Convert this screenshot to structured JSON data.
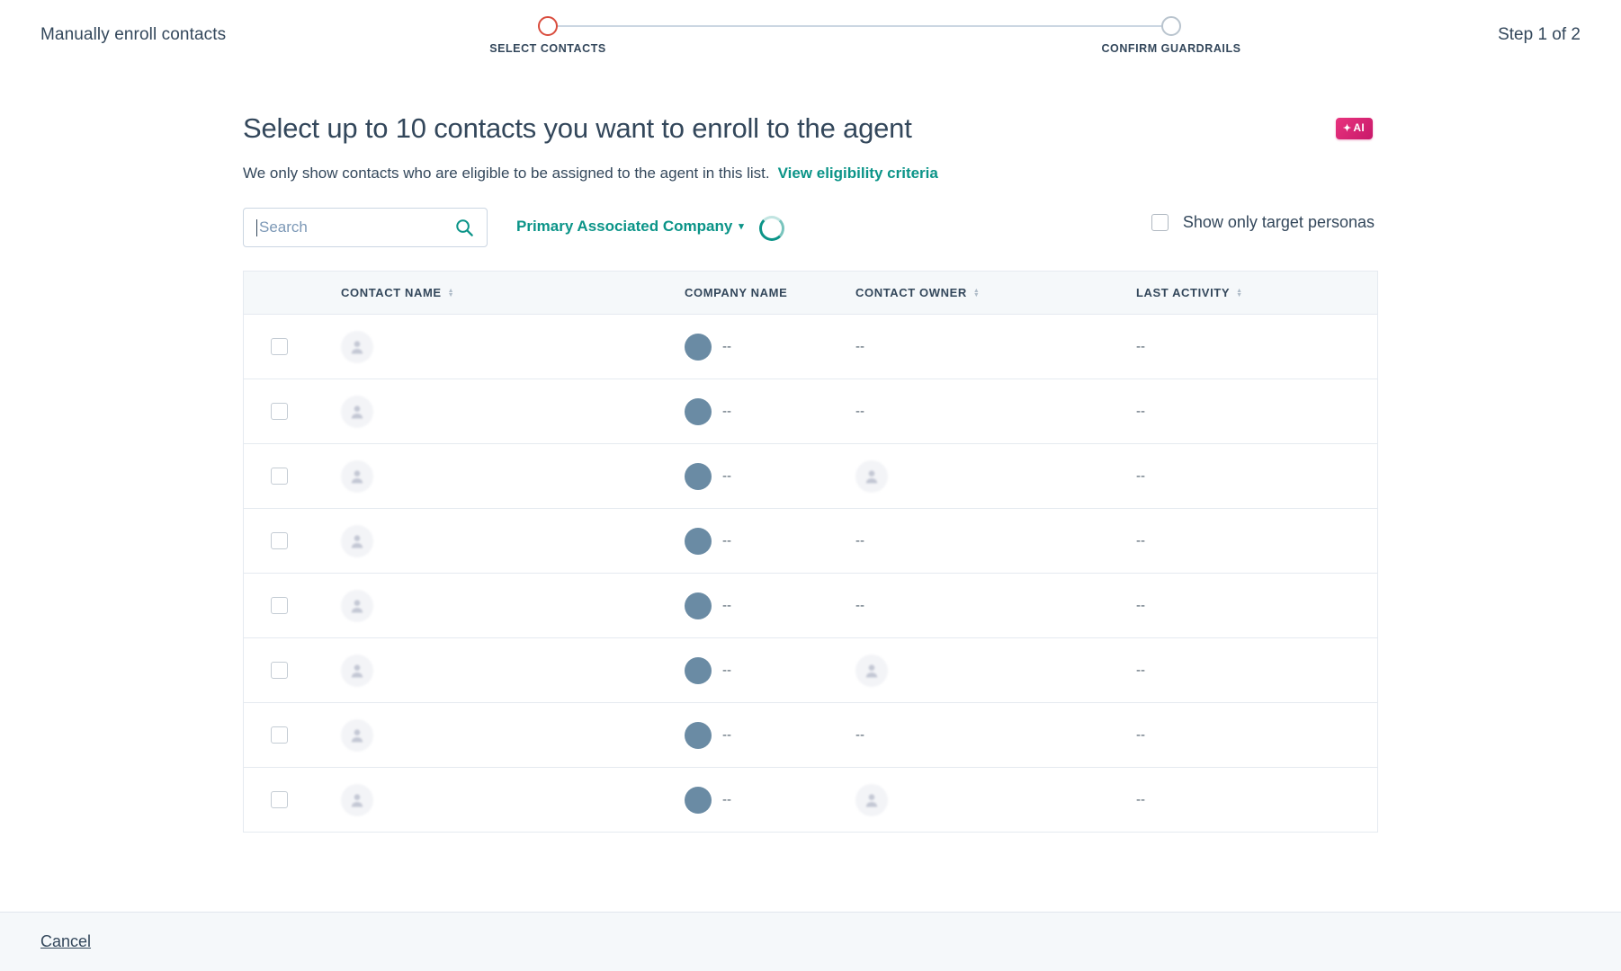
{
  "topbar": {
    "title": "Manually enroll contacts",
    "step_indicator": "Step 1 of 2",
    "steps": [
      {
        "label": "SELECT CONTACTS",
        "state": "active"
      },
      {
        "label": "CONFIRM GUARDRAILS",
        "state": "inactive"
      }
    ]
  },
  "main": {
    "headline": "Select up to 10 contacts you want to enroll to the agent",
    "ai_badge": {
      "spark": "✦",
      "label": "AI"
    },
    "subtitle": "We only show contacts who are eligible to be assigned to the agent in this list.",
    "subtitle_link": "View eligibility criteria"
  },
  "controls": {
    "search_placeholder": "Search",
    "search_value": "",
    "search_icon": "search-icon",
    "filter_dropdown": "Primary Associated Company",
    "filter_caret": "▾",
    "loading": true,
    "persona_checkbox_label": "Show only target personas",
    "persona_checked": false
  },
  "table": {
    "columns": [
      {
        "key": "contact_name",
        "label": "CONTACT NAME",
        "sortable": true
      },
      {
        "key": "company_name",
        "label": "COMPANY NAME",
        "sortable": false
      },
      {
        "key": "contact_owner",
        "label": "CONTACT OWNER",
        "sortable": true
      },
      {
        "key": "last_activity",
        "label": "LAST ACTIVITY",
        "sortable": true
      }
    ],
    "empty_value": "--",
    "rows": [
      {
        "selected": false,
        "contact_name": "",
        "company_name": "--",
        "contact_owner": "--",
        "contact_owner_avatar": false,
        "last_activity": "--"
      },
      {
        "selected": false,
        "contact_name": "",
        "company_name": "--",
        "contact_owner": "--",
        "contact_owner_avatar": false,
        "last_activity": "--"
      },
      {
        "selected": false,
        "contact_name": "",
        "company_name": "--",
        "contact_owner": "",
        "contact_owner_avatar": true,
        "last_activity": "--"
      },
      {
        "selected": false,
        "contact_name": "",
        "company_name": "--",
        "contact_owner": "--",
        "contact_owner_avatar": false,
        "last_activity": "--"
      },
      {
        "selected": false,
        "contact_name": "",
        "company_name": "--",
        "contact_owner": "--",
        "contact_owner_avatar": false,
        "last_activity": "--"
      },
      {
        "selected": false,
        "contact_name": "",
        "company_name": "--",
        "contact_owner": "",
        "contact_owner_avatar": true,
        "last_activity": "--"
      },
      {
        "selected": false,
        "contact_name": "",
        "company_name": "--",
        "contact_owner": "--",
        "contact_owner_avatar": false,
        "last_activity": "--"
      },
      {
        "selected": false,
        "contact_name": "",
        "company_name": "--",
        "contact_owner": "",
        "contact_owner_avatar": true,
        "last_activity": "--"
      }
    ]
  },
  "footer": {
    "cancel_label": "Cancel"
  },
  "colors": {
    "accent_teal": "#0b9488",
    "step_active": "#d94c3d",
    "step_inactive": "#b9c4ce",
    "text_primary": "#33475b",
    "ai_badge": "#e8337e",
    "company_dot": "#6a8ba4",
    "header_bg": "#f5f8fa"
  }
}
